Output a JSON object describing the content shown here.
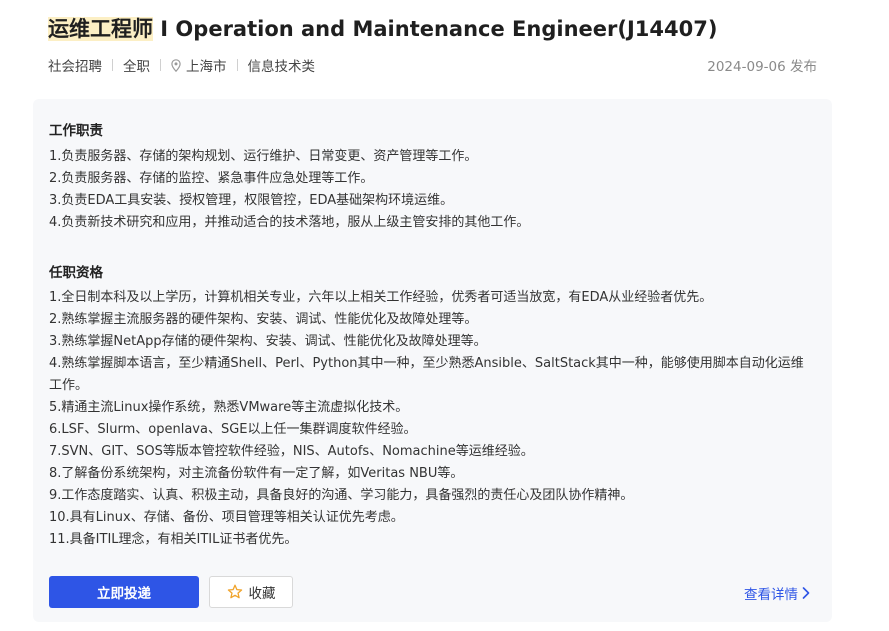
{
  "job": {
    "title_highlight": "运维工程师",
    "title_rest": " I Operation and Maintenance Engineer(J14407)",
    "meta": {
      "recruit_type": "社会招聘",
      "employment": "全职",
      "location": "上海市",
      "category": "信息技术类",
      "posted": "2024-09-06 发布"
    }
  },
  "duties": {
    "heading": "工作职责",
    "items": [
      "1.负责服务器、存储的架构规划、运行维护、日常变更、资产管理等工作。",
      "2.负责服务器、存储的监控、紧急事件应急处理等工作。",
      "3.负责EDA工具安装、授权管理，权限管控，EDA基础架构环境运维。",
      "4.负责新技术研究和应用，并推动适合的技术落地，服从上级主管安排的其他工作。"
    ]
  },
  "requirements": {
    "heading": "任职资格",
    "items": [
      "1.全日制本科及以上学历，计算机相关专业，六年以上相关工作经验，优秀者可适当放宽，有EDA从业经验者优先。",
      "2.熟练掌握主流服务器的硬件架构、安装、调试、性能优化及故障处理等。",
      "3.熟练掌握NetApp存储的硬件架构、安装、调试、性能优化及故障处理等。",
      "4.熟练掌握脚本语言，至少精通Shell、Perl、Python其中一种，至少熟悉Ansible、SaltStack其中一种，能够使用脚本自动化运维工作。",
      "5.精通主流Linux操作系统，熟悉VMware等主流虚拟化技术。",
      "6.LSF、Slurm、openlava、SGE以上任一集群调度软件经验。",
      "7.SVN、GIT、SOS等版本管控软件经验，NIS、Autofs、Nomachine等运维经验。",
      "8.了解备份系统架构，对主流备份软件有一定了解，如Veritas NBU等。",
      "9.工作态度踏实、认真、积极主动，具备良好的沟通、学习能力，具备强烈的责任心及团队协作精神。",
      "10.具有Linux、存储、备份、项目管理等相关认证优先考虑。",
      "11.具备ITIL理念，有相关ITIL证书者优先。"
    ]
  },
  "actions": {
    "apply": "立即投递",
    "favorite": "收藏",
    "details": "查看详情"
  },
  "colors": {
    "primary": "#2e55e6",
    "card_bg": "#f7f8fa",
    "highlight": "#fcefc4",
    "star": "#f0a32a"
  },
  "icons": {
    "location": "location-pin-icon",
    "favorite": "star-outline-icon",
    "details": "chevron-right-icon"
  }
}
